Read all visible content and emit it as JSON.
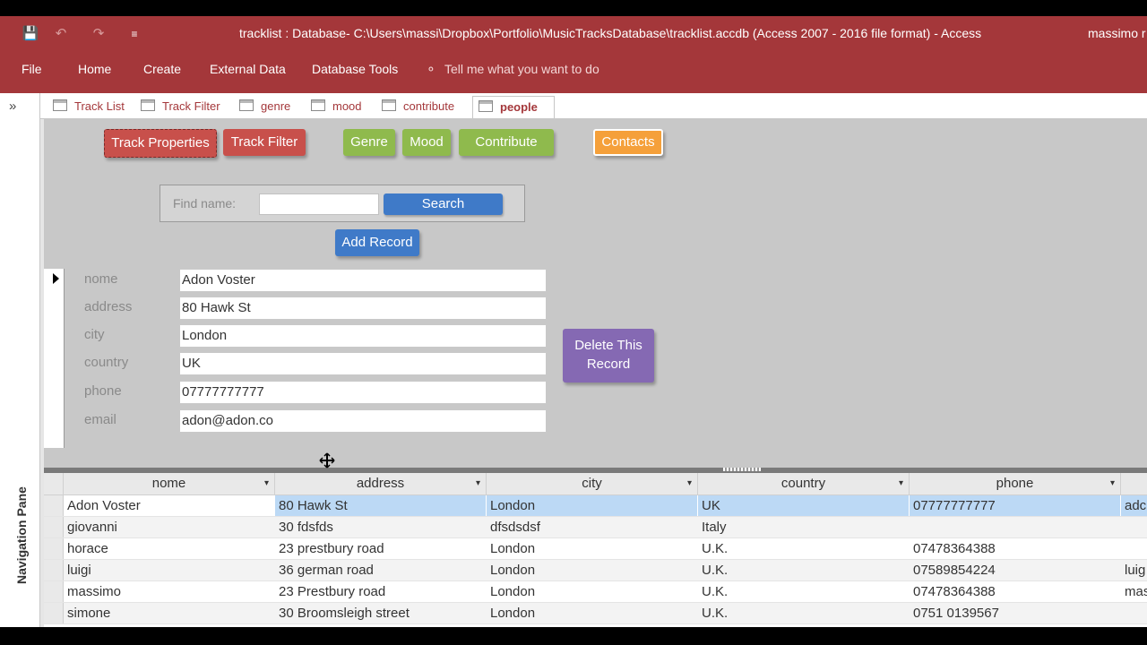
{
  "window": {
    "title": "tracklist : Database- C:\\Users\\massi\\Dropbox\\Portfolio\\MusicTracksDatabase\\tracklist.accdb (Access 2007 - 2016 file format)  -  Access",
    "user": "massimo r"
  },
  "qat": {
    "save_icon": "💾",
    "undo_icon": "↶",
    "redo_icon": "↷",
    "customize_icon": "≡"
  },
  "ribbon": {
    "tabs": [
      "File",
      "Home",
      "Create",
      "External Data",
      "Database Tools"
    ],
    "tell_me": "Tell me what you want to do",
    "tell_icon": "⚬"
  },
  "nav_pane": {
    "label": "Navigation Pane",
    "toggle": "»"
  },
  "doc_tabs": [
    "Track List",
    "Track Filter",
    "genre",
    "mood",
    "contribute",
    "people"
  ],
  "active_tab": "people",
  "form": {
    "buttons": {
      "track_properties": "Track Properties",
      "track_filter": "Track Filter",
      "genre": "Genre",
      "mood": "Mood",
      "contribute": "Contribute",
      "contacts": "Contacts",
      "add_record": "Add Record",
      "delete_record": "Delete This Record"
    },
    "find": {
      "label": "Find name:",
      "value": "",
      "search": "Search"
    },
    "fields": [
      {
        "label": "nome",
        "value": "Adon Voster"
      },
      {
        "label": "address",
        "value": "80 Hawk St"
      },
      {
        "label": "city",
        "value": "London"
      },
      {
        "label": "country",
        "value": "UK"
      },
      {
        "label": "phone",
        "value": "07777777777"
      },
      {
        "label": "email",
        "value": "adon@adon.co"
      }
    ]
  },
  "datasheet": {
    "columns": [
      "nome",
      "address",
      "city",
      "country",
      "phone"
    ],
    "sort_icon": "▾",
    "rows": [
      {
        "nome": "Adon Voster",
        "address": "80 Hawk St",
        "city": "London",
        "country": "UK",
        "phone": "07777777777",
        "email": "adc"
      },
      {
        "nome": "giovanni",
        "address": "30 fdsfds",
        "city": "dfsdsdsf",
        "country": "Italy",
        "phone": "",
        "email": ""
      },
      {
        "nome": "horace",
        "address": "23 prestbury road",
        "city": "London",
        "country": "U.K.",
        "phone": "07478364388",
        "email": ""
      },
      {
        "nome": "luigi",
        "address": "36 german road",
        "city": "London",
        "country": "U.K.",
        "phone": "07589854224",
        "email": "luig"
      },
      {
        "nome": "massimo",
        "address": "23 Prestbury road",
        "city": "London",
        "country": "U.K.",
        "phone": "07478364388",
        "email": "mas"
      },
      {
        "nome": "simone",
        "address": "30 Broomsleigh street",
        "city": "London",
        "country": "U.K.",
        "phone": "0751 0139567",
        "email": ""
      }
    ]
  }
}
